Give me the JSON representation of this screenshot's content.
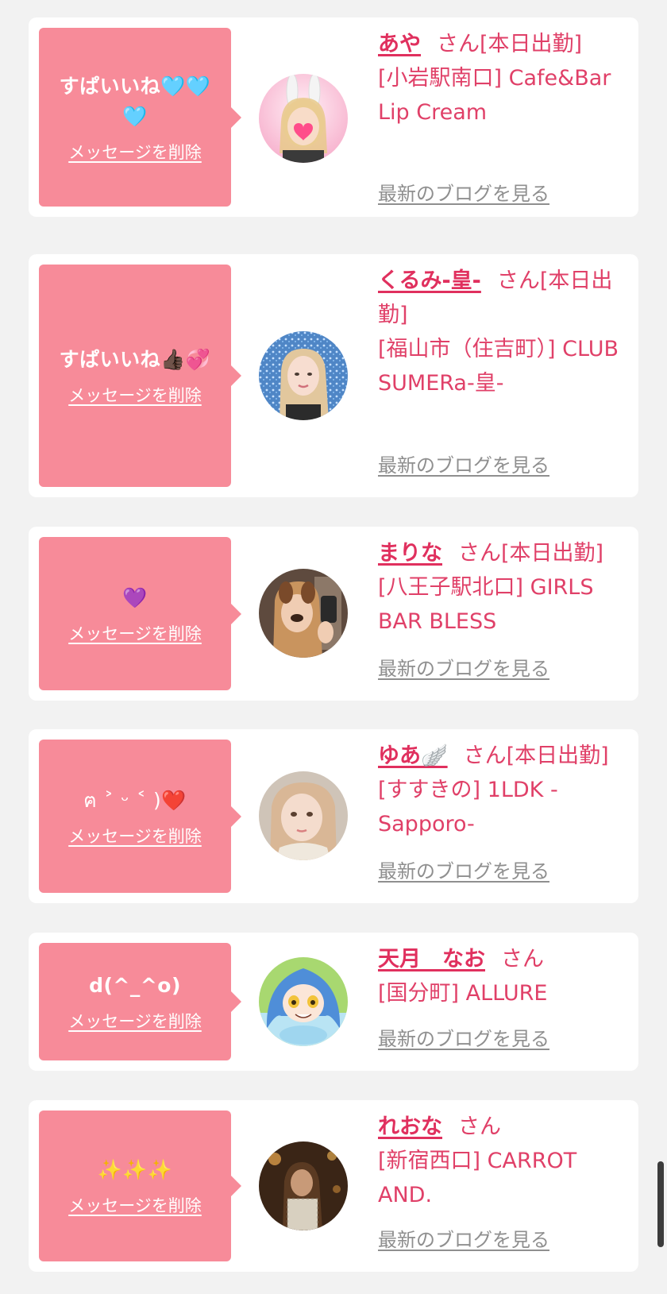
{
  "delete_label": "メッセージを削除",
  "blog_label": "最新のブログを見る",
  "san_suffix": "さん",
  "colors": {
    "bubble": "#f78b99",
    "name": "#e0305e",
    "info_text": "#e04068",
    "blog_link": "#8f8f8f",
    "background": "#f2f2f2"
  },
  "cards": [
    {
      "message": "すぱいいね🩵🩵🩵",
      "name": "あや",
      "status": "[本日出勤]",
      "shop": "[小岩駅南口] Cafe&Bar Lip Cream",
      "avatar_icon": "bunny-ears-girl-avatar"
    },
    {
      "message": "すぱいいね👍🏿💞",
      "name": "くるみ-皇-",
      "status": "[本日出勤]",
      "shop": "[福山市（住吉町）] CLUB SUMERa-皇-",
      "avatar_icon": "blonde-girl-glitter-avatar"
    },
    {
      "message": "💜",
      "name": "まりな",
      "status": "[本日出勤]",
      "shop": "[八王子駅北口] GIRLS BAR BLESS",
      "avatar_icon": "dog-filter-selfie-avatar"
    },
    {
      "message": "ฅ ˃ ᵕ ˂ )❤️",
      "name": "ゆあ🪽",
      "status": "[本日出勤]",
      "shop": "[すすきの] 1LDK -Sapporo-",
      "avatar_icon": "girl-portrait-avatar"
    },
    {
      "message": "d(^_^o)",
      "name": "天月　なお",
      "status": "",
      "shop": "[国分町] ALLURE",
      "avatar_icon": "anime-blue-hair-avatar"
    },
    {
      "message": "✨✨✨",
      "name": "れおな",
      "status": "",
      "shop": "[新宿西口] CARROT AND.",
      "avatar_icon": "dark-portrait-avatar"
    }
  ]
}
